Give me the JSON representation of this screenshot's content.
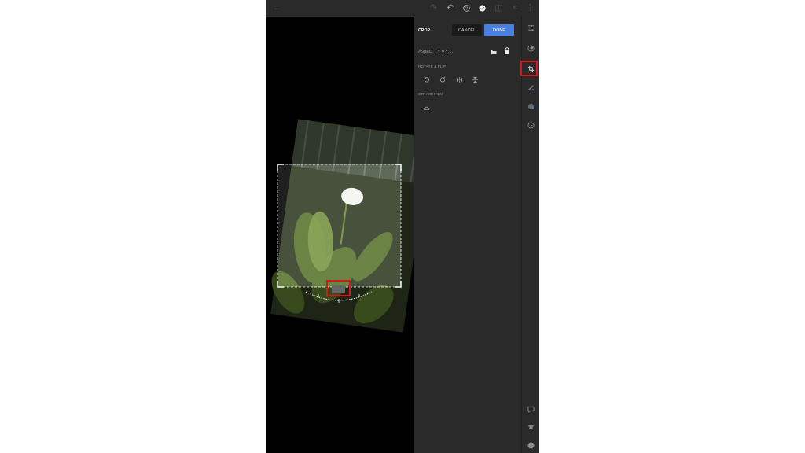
{
  "topbar": {
    "back_icon": "←",
    "redo_icon": "↷",
    "undo_icon": "↶",
    "help_icon": "?",
    "check_icon": "✓",
    "compare_icon": "◫",
    "share_icon": "<",
    "more_icon": "⋮"
  },
  "panel": {
    "title": "CROP",
    "cancel_label": "CANCEL",
    "done_label": "DONE",
    "aspect_label": "Aspect",
    "aspect_value": "1 x 1",
    "rotate_flip_label": "ROTATE & FLIP",
    "straighten_label": "STRAIGHTEN"
  },
  "colors": {
    "accent": "#4a7fe0",
    "highlight": "#d11a1a",
    "panel_bg": "#2a2a2a"
  }
}
